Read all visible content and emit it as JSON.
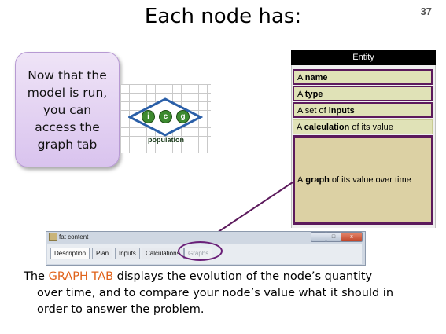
{
  "slide": {
    "title": "Each node has:",
    "page_number": "37"
  },
  "callout": {
    "text": "Now that the model is run, you can access the graph tab"
  },
  "node": {
    "label": "population",
    "badges": [
      "i",
      "c",
      "g"
    ]
  },
  "entity": {
    "header": "Entity",
    "rows": [
      {
        "prefix": "A ",
        "bold": "name",
        "suffix": ""
      },
      {
        "prefix": "A ",
        "bold": "type",
        "suffix": ""
      },
      {
        "prefix": "A set of ",
        "bold": "inputs",
        "suffix": ""
      },
      {
        "prefix": "A ",
        "bold": "calculation",
        "suffix": " of its value"
      }
    ],
    "graph_row": {
      "prefix": "A ",
      "bold": "graph",
      "suffix": " of its value over time"
    }
  },
  "window": {
    "title": "fat content",
    "buttons": [
      "–",
      "□",
      "x"
    ],
    "tabs": [
      "Description",
      "Plan",
      "Inputs",
      "Calculations",
      "Graphs"
    ]
  },
  "description": {
    "lead": "The ",
    "highlight": "GRAPH TAB",
    "line1_rest": " displays the evolution of the node’s quantity",
    "line2": "over time, and to compare your node’s value what it should in",
    "line3": "order to answer the problem."
  },
  "colors": {
    "highlight": "#e0621a",
    "accent_purple": "#5c1a5c",
    "callout_fill": "#e3d2f2"
  }
}
